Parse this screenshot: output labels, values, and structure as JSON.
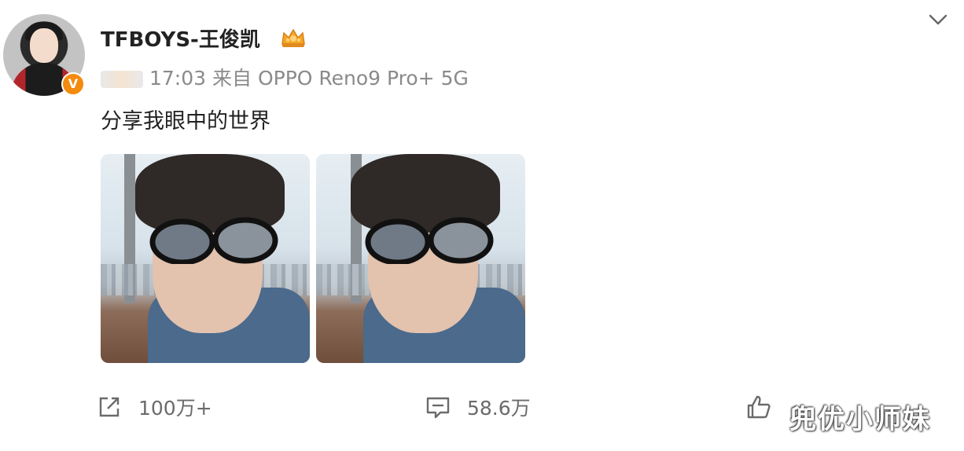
{
  "post": {
    "username": "TFBOYS-王俊凯",
    "verified_badge": "V",
    "crown_icon": "crown-icon",
    "meta": {
      "time": "17:03",
      "source": "来自 OPPO Reno9 Pro+ 5G"
    },
    "text": "分享我眼中的世界",
    "images": [
      "photo-1",
      "photo-2"
    ],
    "actions": {
      "share": "100万+",
      "comment": "58.6万",
      "like": ""
    },
    "watermark": "兜优小师妹",
    "colors": {
      "accent": "#f38b0f",
      "text": "#222222",
      "muted": "#8a8a8a"
    }
  }
}
